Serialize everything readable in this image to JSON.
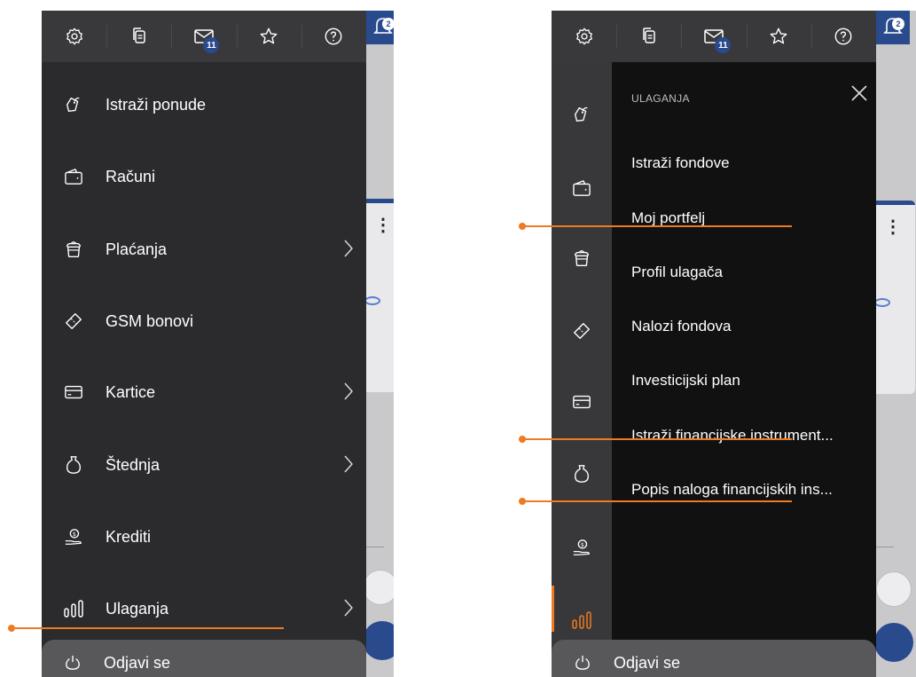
{
  "top_icons": [
    {
      "icon": "gear-icon"
    },
    {
      "icon": "document-copy-icon"
    },
    {
      "icon": "mail-icon",
      "badge": "11"
    },
    {
      "icon": "star-icon"
    },
    {
      "icon": "help-icon"
    }
  ],
  "notification_badge": "2",
  "menu": {
    "items": [
      {
        "label": "Istraži ponude",
        "icon": "tag-icon",
        "chevron": false
      },
      {
        "label": "Računi",
        "icon": "wallet-icon",
        "chevron": false
      },
      {
        "label": "Plaćanja",
        "icon": "money-pot-icon",
        "chevron": true
      },
      {
        "label": "GSM bonovi",
        "icon": "voucher-icon",
        "chevron": false
      },
      {
        "label": "Kartice",
        "icon": "card-icon",
        "chevron": true
      },
      {
        "label": "Štednja",
        "icon": "savings-icon",
        "chevron": true
      },
      {
        "label": "Krediti",
        "icon": "loan-icon",
        "chevron": false
      },
      {
        "label": "Ulaganja",
        "icon": "investment-icon",
        "chevron": true
      }
    ],
    "logout": "Odjavi se"
  },
  "submenu": {
    "title": "ULAGANJA",
    "items": [
      "Istraži fondove",
      "Moj portfelj",
      "Profil ulagača",
      "Nalozi fondova",
      "Investicijski plan",
      "Istraži financijske instrument...",
      "Popis naloga financijskih ins..."
    ]
  },
  "colors": {
    "accent": "#ee7a21",
    "drawer": "#2b2b2d",
    "topbar": "#39393b",
    "submenu": "#111112",
    "brand_blue": "#2a4a8e"
  }
}
